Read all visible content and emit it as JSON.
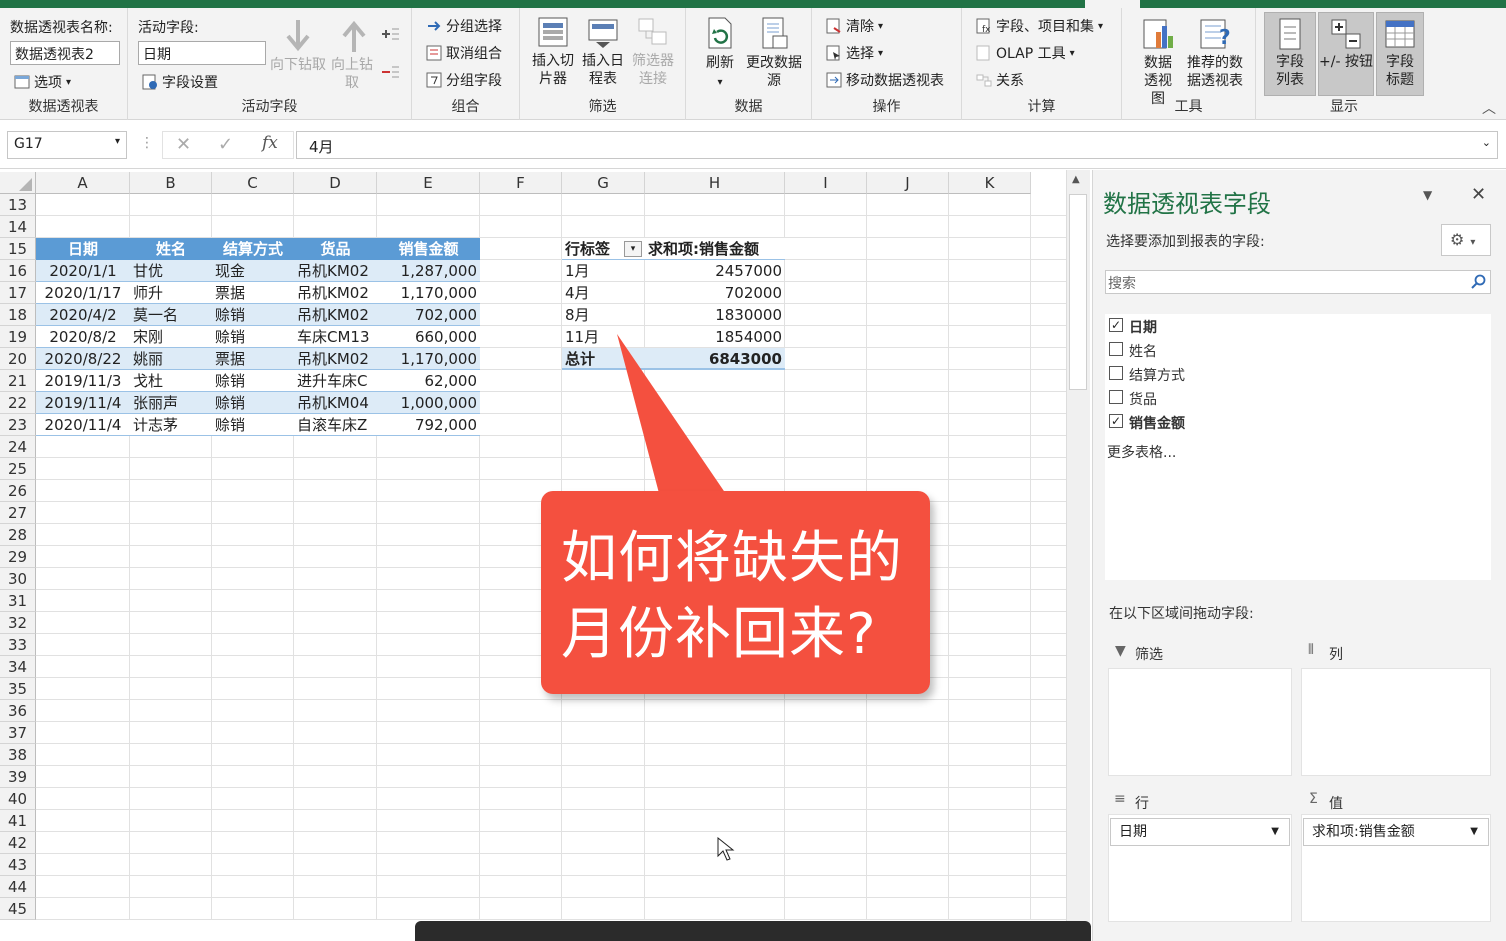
{
  "ribbon": {
    "pivot_name_label": "数据透视表名称:",
    "pivot_name_value": "数据透视表2",
    "options_label": "选项",
    "group1_label": "数据透视表",
    "active_field_label": "活动字段:",
    "active_field_value": "日期",
    "field_settings_label": "字段设置",
    "drill_down_label": "向下钻取",
    "drill_up_label": "向上钻取",
    "group2_label": "活动字段",
    "group_selection_label": "分组选择",
    "ungroup_label": "取消组合",
    "group_field_label": "分组字段",
    "group3_label": "组合",
    "insert_slicer_label": "插入切片器",
    "insert_timeline_label": "插入日程表",
    "filter_connections_label": "筛选器连接",
    "group4_label": "筛选",
    "refresh_label": "刷新",
    "change_source_label": "更改数据源",
    "group5_label": "数据",
    "clear_label": "清除",
    "select_label": "选择",
    "move_pivot_label": "移动数据透视表",
    "group6_label": "操作",
    "fields_items_sets_label": "字段、项目和集",
    "olap_tools_label": "OLAP 工具",
    "relationships_label": "关系",
    "group7_label": "计算",
    "pivot_chart_label": "数据透视图",
    "recommended_pivot_label": "推荐的数据透视表",
    "group8_label": "工具",
    "field_list_label": "字段列表",
    "buttons_label": "+/- 按钮",
    "field_headers_label": "字段标题",
    "group9_label": "显示"
  },
  "formula_bar": {
    "name_box": "G17",
    "fx": "fx",
    "formula": "4月"
  },
  "columns": [
    "A",
    "B",
    "C",
    "D",
    "E",
    "F",
    "G",
    "H",
    "I",
    "J",
    "K"
  ],
  "rows": [
    "13",
    "14",
    "15",
    "16",
    "17",
    "18",
    "19",
    "20",
    "21",
    "22",
    "23",
    "24",
    "25",
    "26",
    "27",
    "28",
    "29",
    "30",
    "31",
    "32",
    "33",
    "34",
    "35",
    "36",
    "37",
    "38",
    "39",
    "40",
    "41",
    "42",
    "43",
    "44",
    "45"
  ],
  "source_table": {
    "headers": [
      "日期",
      "姓名",
      "结算方式",
      "货品",
      "销售金额"
    ],
    "rows": [
      [
        "2020/1/1",
        "甘优",
        "现金",
        "吊机KM02",
        "1,287,000"
      ],
      [
        "2020/1/17",
        "师升",
        "票据",
        "吊机KM02",
        "1,170,000"
      ],
      [
        "2020/4/2",
        "莫一名",
        "赊销",
        "吊机KM02",
        "702,000"
      ],
      [
        "2020/8/2",
        "宋刚",
        "赊销",
        "车床CM13",
        "660,000"
      ],
      [
        "2020/8/22",
        "姚丽",
        "票据",
        "吊机KM02",
        "1,170,000"
      ],
      [
        "2019/11/3",
        "戈杜",
        "赊销",
        "进升车床C",
        "62,000"
      ],
      [
        "2019/11/4",
        "张丽声",
        "赊销",
        "吊机KM04",
        "1,000,000"
      ],
      [
        "2020/11/4",
        "计志茅",
        "赊销",
        "自滚车床Z",
        "792,000"
      ]
    ]
  },
  "pivot_table": {
    "row_label_header": "行标签",
    "value_header": "求和项:销售金额",
    "rows": [
      [
        "1月",
        "2457000"
      ],
      [
        "4月",
        "702000"
      ],
      [
        "8月",
        "1830000"
      ],
      [
        "11月",
        "1854000"
      ]
    ],
    "total_label": "总计",
    "total_value": "6843000"
  },
  "callout_text": "如何将缺失的月份补回来?",
  "field_panel": {
    "title": "数据透视表字段",
    "subtitle": "选择要添加到报表的字段:",
    "search_placeholder": "搜索",
    "fields": [
      {
        "name": "日期",
        "checked": true
      },
      {
        "name": "姓名",
        "checked": false
      },
      {
        "name": "结算方式",
        "checked": false
      },
      {
        "name": "货品",
        "checked": false
      },
      {
        "name": "销售金额",
        "checked": true
      }
    ],
    "more_tables": "更多表格...",
    "drag_label": "在以下区域间拖动字段:",
    "filters_label": "筛选",
    "columns_label": "列",
    "rows_label": "行",
    "values_label": "值",
    "rows_field": "日期",
    "values_field": "求和项:销售金额"
  },
  "colors": {
    "excel_green": "#217346",
    "table_blue": "#5b9bd5",
    "table_band": "#ddebf7",
    "callout_red": "#f4503f",
    "panel_title_green": "#217346"
  }
}
